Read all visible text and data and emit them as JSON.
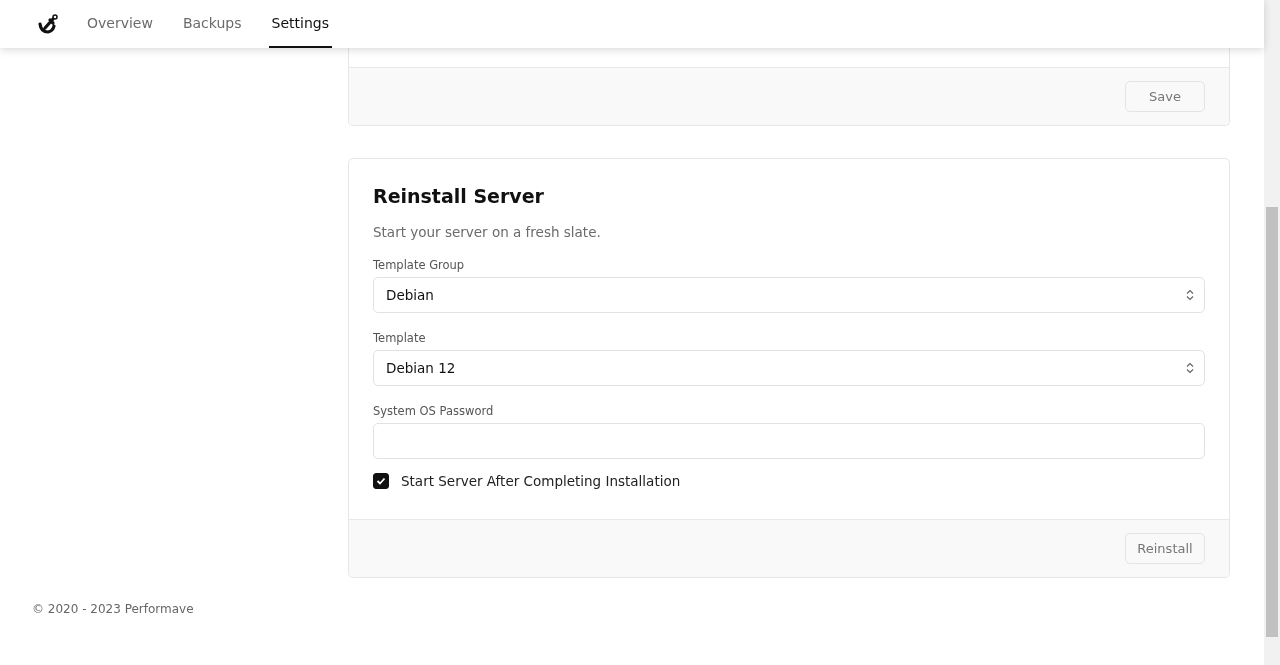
{
  "nav": {
    "tabs": [
      {
        "label": "Overview",
        "selected": false
      },
      {
        "label": "Backups",
        "selected": false
      },
      {
        "label": "Settings",
        "selected": true
      }
    ]
  },
  "previous_card": {
    "button": "Save"
  },
  "reinstall_card": {
    "title": "Reinstall Server",
    "description": "Start your server on a fresh slate.",
    "fields": [
      {
        "kind": "select",
        "label": "Template Group",
        "value": "Debian"
      },
      {
        "kind": "select",
        "label": "Template",
        "value": "Debian 12"
      },
      {
        "kind": "input",
        "label": "System OS Password"
      }
    ],
    "checkbox": {
      "label": "Start Server After Completing Installation",
      "checked": true
    },
    "button": "Reinstall"
  },
  "footer": {
    "copyright": "© 2020 - 2023 Performave"
  }
}
